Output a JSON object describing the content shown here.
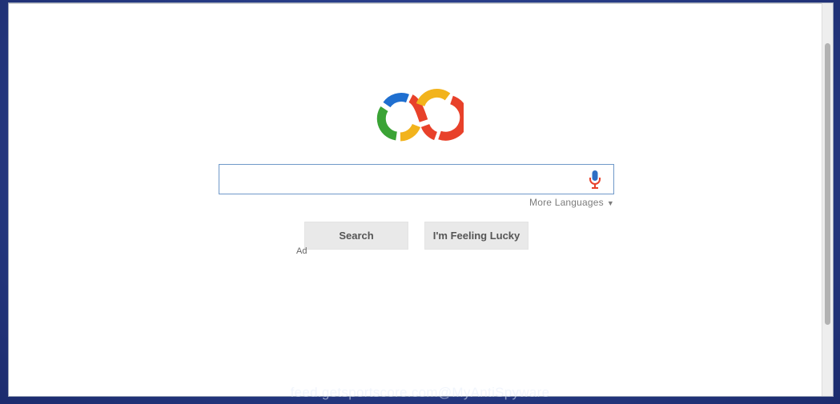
{
  "search": {
    "value": "",
    "placeholder": ""
  },
  "more_languages": {
    "label": "More Languages",
    "caret": "▼"
  },
  "buttons": {
    "search_label": "Search",
    "lucky_label": "I'm Feeling Lucky"
  },
  "ad_label": "Ad",
  "watermark": "feed.getsportscore.com@MyAntiSpyware",
  "icons": {
    "logo": "infinity-logo",
    "mic": "microphone-icon"
  },
  "colors": {
    "logo_blue": "#1f6fd0",
    "logo_green": "#3aa335",
    "logo_yellow": "#f2b31c",
    "logo_red": "#e8412a",
    "search_border": "#6f99c9",
    "button_bg": "#e9e9e9"
  }
}
